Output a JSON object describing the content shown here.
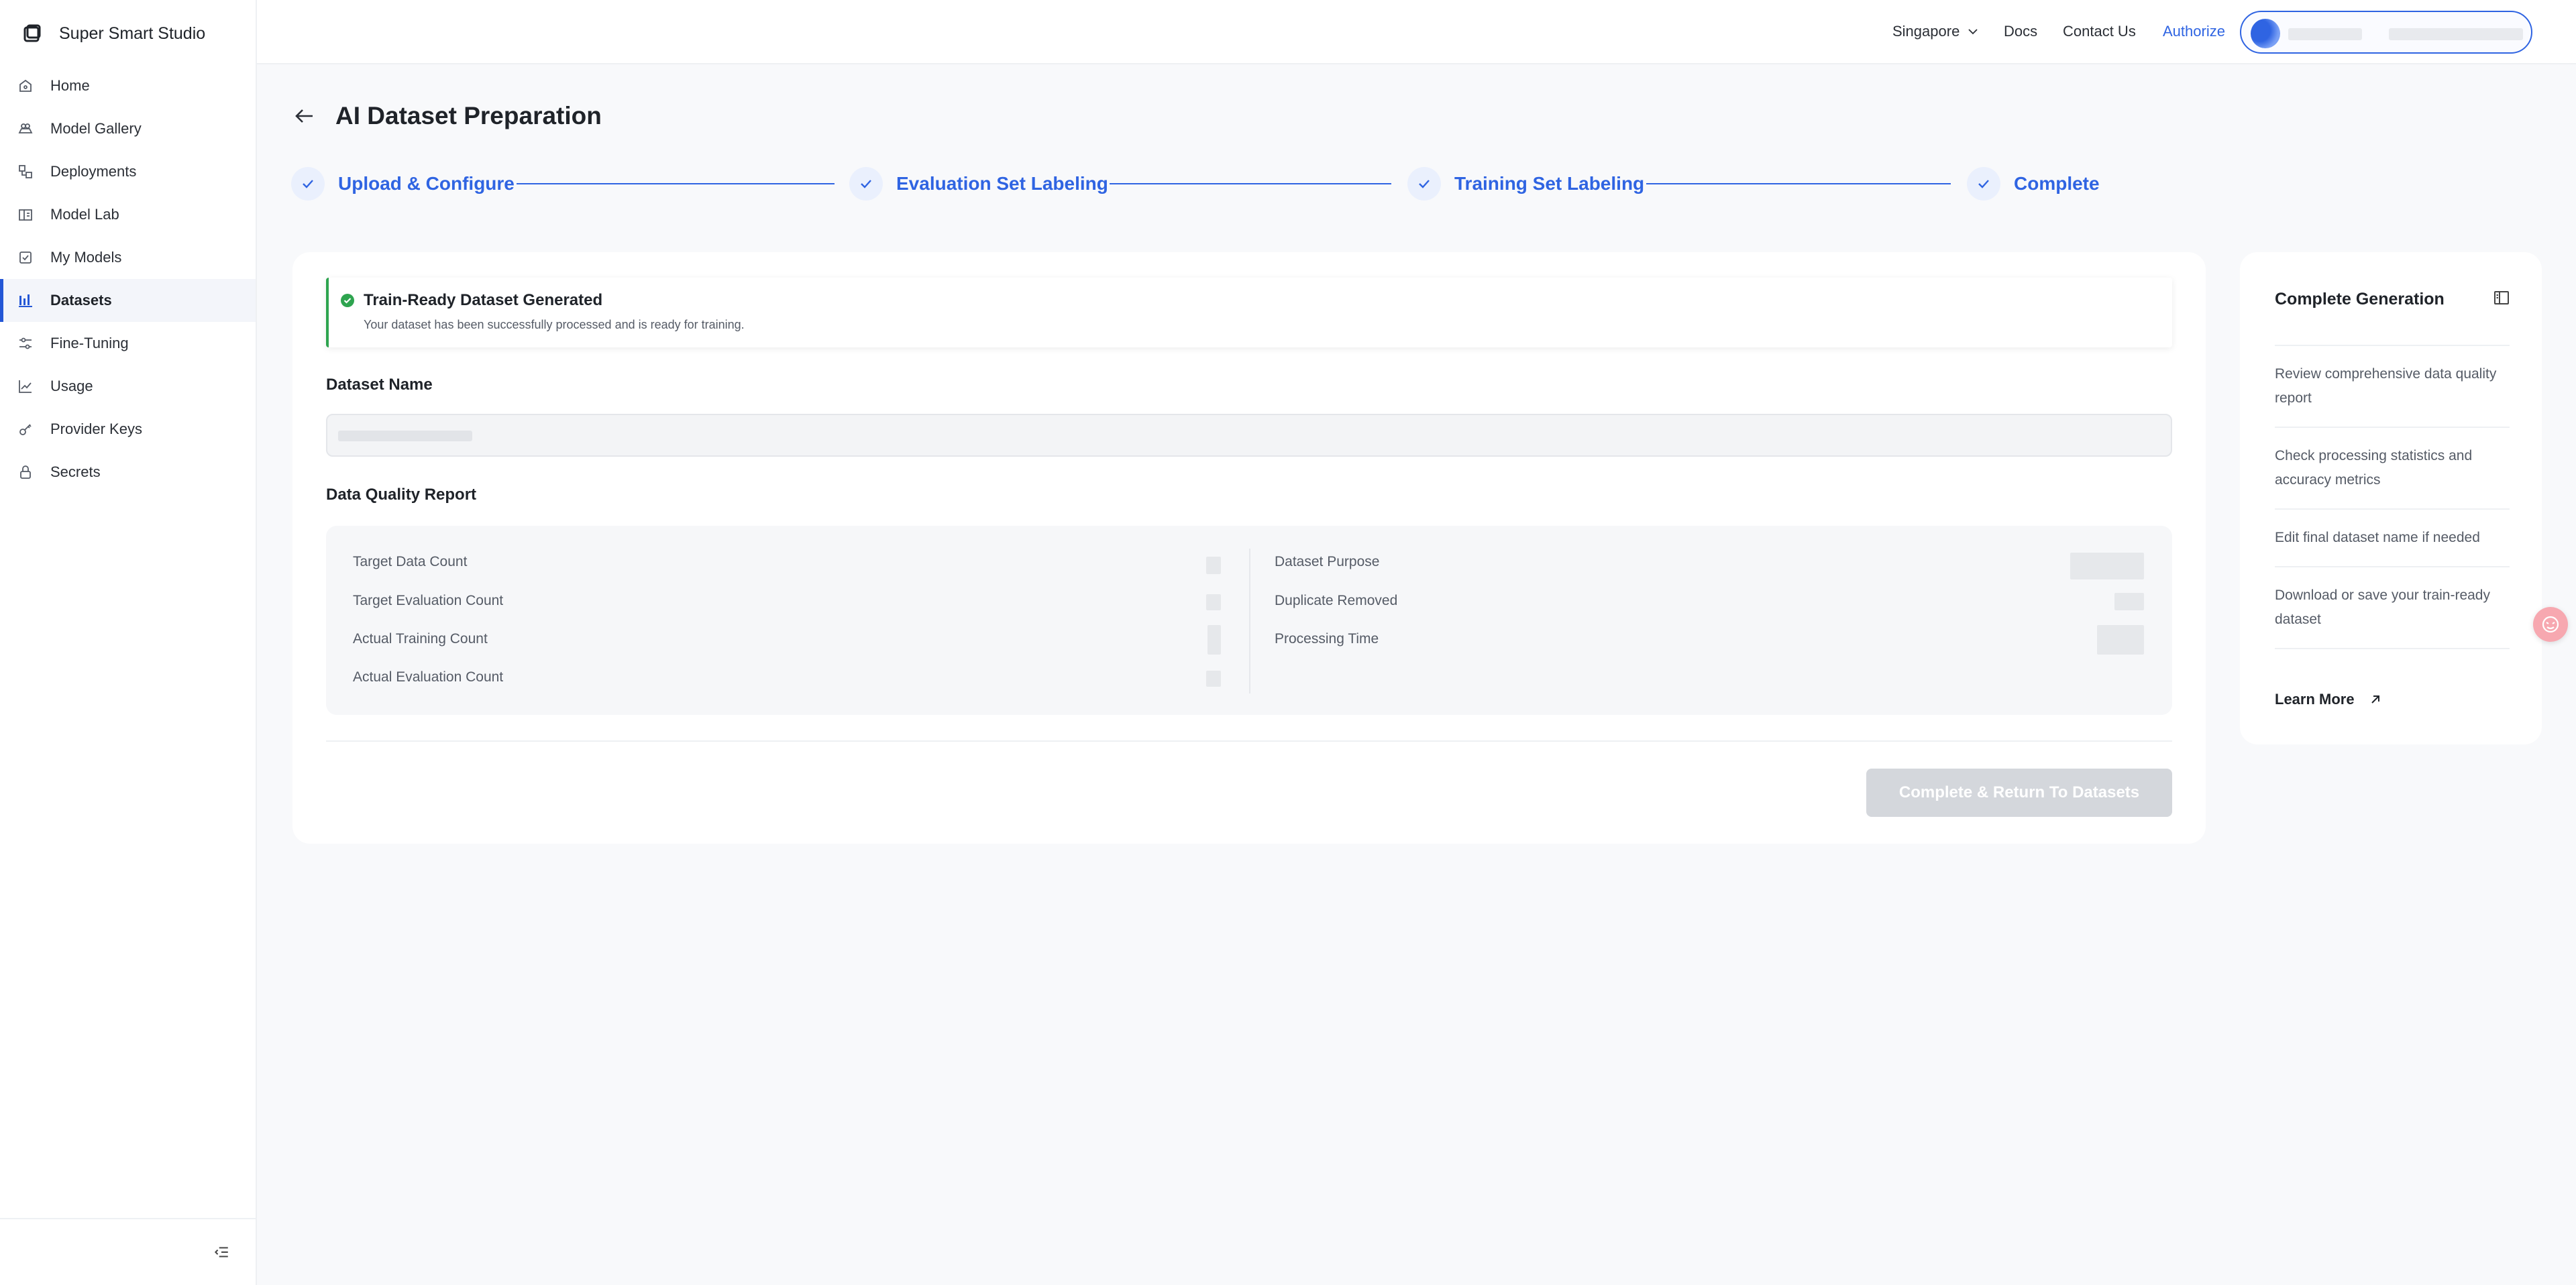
{
  "app": {
    "name": "Super Smart Studio"
  },
  "sidebar": {
    "items": [
      {
        "label": "Home",
        "icon": "home-icon"
      },
      {
        "label": "Model Gallery",
        "icon": "gallery-icon"
      },
      {
        "label": "Deployments",
        "icon": "deployments-icon"
      },
      {
        "label": "Model Lab",
        "icon": "lab-icon"
      },
      {
        "label": "My Models",
        "icon": "models-icon"
      },
      {
        "label": "Datasets",
        "icon": "datasets-icon",
        "active": true
      },
      {
        "label": "Fine-Tuning",
        "icon": "sliders-icon"
      },
      {
        "label": "Usage",
        "icon": "usage-chart-icon"
      },
      {
        "label": "Provider Keys",
        "icon": "key-icon"
      },
      {
        "label": "Secrets",
        "icon": "lock-icon"
      }
    ],
    "collapse_icon": "collapse-sidebar-icon"
  },
  "topbar": {
    "region": "Singapore",
    "docs": "Docs",
    "contact": "Contact Us",
    "authorize": "Authorize"
  },
  "page": {
    "title": "AI Dataset Preparation"
  },
  "steps": [
    {
      "label": "Upload & Configure",
      "status": "done"
    },
    {
      "label": "Evaluation Set Labeling",
      "status": "done"
    },
    {
      "label": "Training Set Labeling",
      "status": "done"
    },
    {
      "label": "Complete",
      "status": "done"
    }
  ],
  "banner": {
    "title": "Train-Ready Dataset Generated",
    "description": "Your dataset has been successfully processed and is ready for training."
  },
  "dataset_name": {
    "label": "Dataset Name"
  },
  "report": {
    "title": "Data Quality Report",
    "left": [
      {
        "label": "Target Data Count"
      },
      {
        "label": "Target Evaluation Count"
      },
      {
        "label": "Actual Training Count"
      },
      {
        "label": "Actual Evaluation Count"
      }
    ],
    "right": [
      {
        "label": "Dataset Purpose"
      },
      {
        "label": "Duplicate Removed"
      },
      {
        "label": "Processing Time"
      }
    ]
  },
  "actions": {
    "complete": "Complete & Return To Datasets"
  },
  "panel": {
    "title": "Complete Generation",
    "items": [
      "Review comprehensive data quality report",
      "Check processing statistics and accuracy metrics",
      "Edit final dataset name if needed",
      "Download or save your train-ready dataset"
    ],
    "learn_more": "Learn More"
  },
  "colors": {
    "accent": "#2f64e2",
    "success": "#2ea44f",
    "disabled_button": "#d4d7dc"
  }
}
